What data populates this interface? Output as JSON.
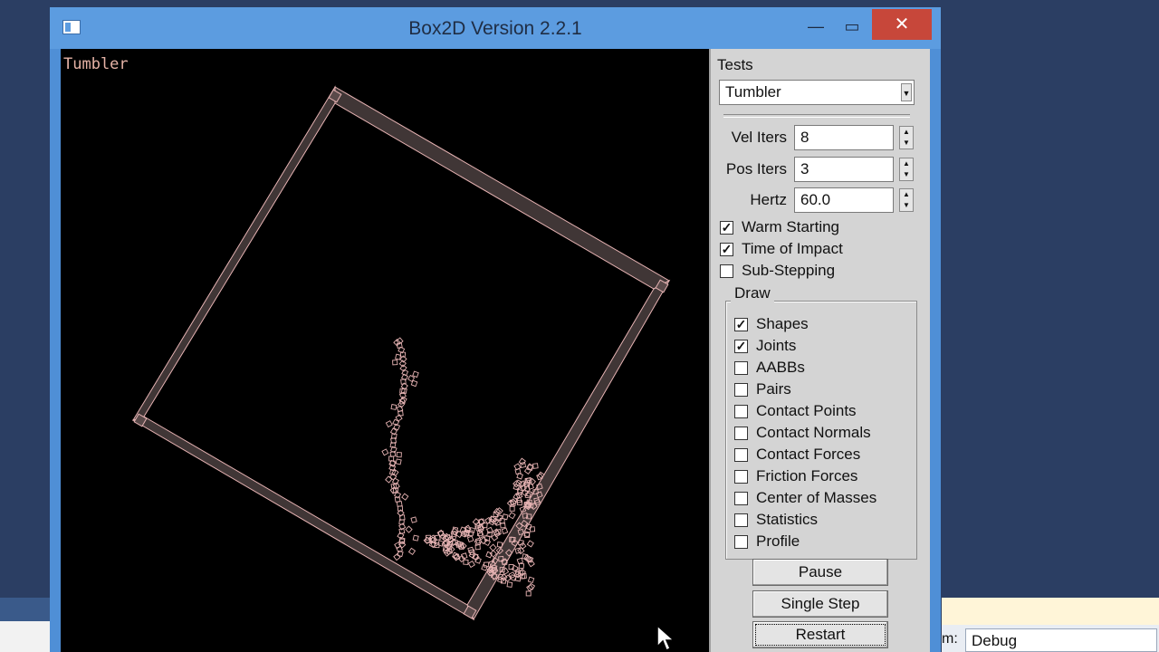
{
  "window": {
    "title": "Box2D Version 2.2.1",
    "minimize": "—",
    "maximize": "▭",
    "close": "✕"
  },
  "canvas": {
    "test_name": "Tumbler",
    "colors": {
      "frame_fill": "#403636",
      "frame_stroke": "#e6b3b3",
      "particles": "#e6b3b3"
    }
  },
  "panel": {
    "tests_label": "Tests",
    "tests_selected": "Tumbler",
    "vel_iters_label": "Vel Iters",
    "vel_iters_value": "8",
    "pos_iters_label": "Pos Iters",
    "pos_iters_value": "3",
    "hertz_label": "Hertz",
    "hertz_value": "60.0",
    "options": [
      {
        "label": "Warm Starting",
        "checked": true
      },
      {
        "label": "Time of Impact",
        "checked": true
      },
      {
        "label": "Sub-Stepping",
        "checked": false
      }
    ],
    "draw_label": "Draw",
    "draw_options": [
      {
        "label": "Shapes",
        "checked": true
      },
      {
        "label": "Joints",
        "checked": true
      },
      {
        "label": "AABBs",
        "checked": false
      },
      {
        "label": "Pairs",
        "checked": false
      },
      {
        "label": "Contact Points",
        "checked": false
      },
      {
        "label": "Contact Normals",
        "checked": false
      },
      {
        "label": "Contact Forces",
        "checked": false
      },
      {
        "label": "Friction Forces",
        "checked": false
      },
      {
        "label": "Center of Masses",
        "checked": false
      },
      {
        "label": "Statistics",
        "checked": false
      },
      {
        "label": "Profile",
        "checked": false
      }
    ],
    "pause_label": "Pause",
    "single_step_label": "Single Step",
    "restart_label": "Restart"
  },
  "background": {
    "config_label": "m:",
    "config_value": "Debug"
  }
}
